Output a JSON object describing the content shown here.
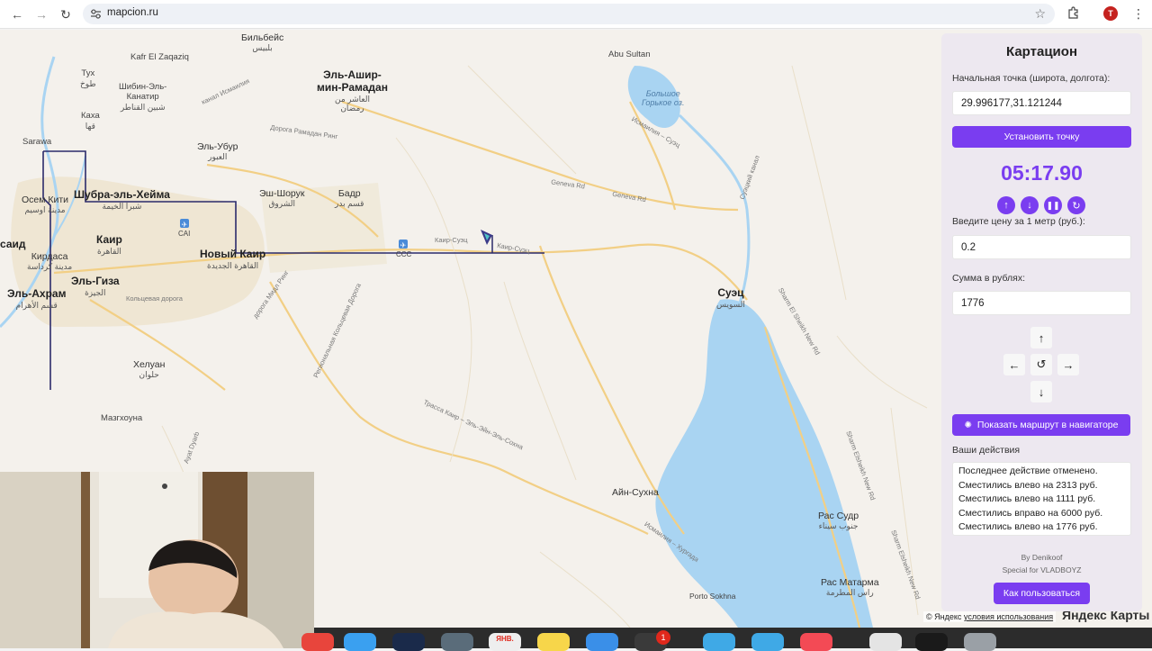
{
  "browser": {
    "url": "mapcion.ru",
    "profile_initial": "T",
    "icons": {
      "back": "arrow-left-icon",
      "forward": "arrow-right-icon",
      "reload": "reload-icon",
      "site": "site-settings-icon",
      "bookmark": "star-icon",
      "extensions": "puzzle-icon",
      "menu": "more-vert-icon"
    }
  },
  "map": {
    "labels": [
      {
        "id": "bilbeis",
        "name": "Бильбейс",
        "sub": "بلبيس",
        "cls": "mid"
      },
      {
        "id": "tukh",
        "name": "Тух",
        "sub": "طوخ",
        "cls": ""
      },
      {
        "id": "kafr",
        "name": "Kafr El Zaqaziq",
        "sub": "",
        "cls": ""
      },
      {
        "id": "shibin",
        "name": "Шибин-Эль-\nКанатир",
        "sub": "شبين القناطر",
        "cls": ""
      },
      {
        "id": "ashir",
        "name": "Эль-Ашир-\nмин-Рамадан",
        "sub": "العاشر من\nرمضان",
        "cls": "big"
      },
      {
        "id": "abusultan",
        "name": "Abu Sultan",
        "sub": "",
        "cls": ""
      },
      {
        "id": "lake",
        "name": "Большое\nГорькое оз.",
        "sub": "",
        "cls": "water"
      },
      {
        "id": "kaha",
        "name": "Каха",
        "sub": "قها",
        "cls": ""
      },
      {
        "id": "sarawa",
        "name": "Sarawa",
        "sub": "",
        "cls": ""
      },
      {
        "id": "ubur",
        "name": "Эль-Убур",
        "sub": "العبور",
        "cls": "mid"
      },
      {
        "id": "osim",
        "name": "Осем Кити",
        "sub": "مدينة اوسيم",
        "cls": "mid"
      },
      {
        "id": "shubra",
        "name": "Шубра-эль-Хейма",
        "sub": "شبرا الخيمة",
        "cls": "big"
      },
      {
        "id": "shorouk",
        "name": "Эш-Шорук",
        "sub": "الشروق",
        "cls": "mid"
      },
      {
        "id": "badr",
        "name": "Бадр",
        "sub": "قسم بدر",
        "cls": "mid"
      },
      {
        "id": "cai",
        "name": "CAI",
        "sub": "",
        "cls": ""
      },
      {
        "id": "cairo",
        "name": "Каир",
        "sub": "القاهرة",
        "cls": "big"
      },
      {
        "id": "newcairo",
        "name": "Новый Каир",
        "sub": "القاهرة الجديدة",
        "cls": "big"
      },
      {
        "id": "ccc",
        "name": "CCC",
        "sub": "",
        "cls": ""
      },
      {
        "id": "kirdasa",
        "name": "Кирдаса",
        "sub": "مدينة كرداسة",
        "cls": "mid"
      },
      {
        "id": "giza",
        "name": "Эль-Гиза",
        "sub": "الجيزة",
        "cls": "big"
      },
      {
        "id": "ahram",
        "name": "Эль-Ахрам",
        "sub": "قسم الأهرام",
        "cls": "big"
      },
      {
        "id": "said",
        "name": "саид",
        "sub": "",
        "cls": "big"
      },
      {
        "id": "suez",
        "name": "Суэц",
        "sub": "السويس",
        "cls": "big"
      },
      {
        "id": "helwan",
        "name": "Хелуан",
        "sub": "حلوان",
        "cls": "mid"
      },
      {
        "id": "mazghouna",
        "name": "Мазгхоуна",
        "sub": "",
        "cls": ""
      },
      {
        "id": "ainsukhna",
        "name": "Айн-Сухна",
        "sub": "",
        "cls": "mid"
      },
      {
        "id": "rassudr",
        "name": "Рас Судр",
        "sub": "جنوب سيناء",
        "cls": "mid"
      },
      {
        "id": "rasmatarma",
        "name": "Рас Матарма",
        "sub": "راس المطرمة",
        "cls": "mid"
      },
      {
        "id": "portosokhna",
        "name": "Porto Sokhna",
        "sub": "",
        "cls": ""
      }
    ],
    "roads": [
      {
        "id": "r1",
        "name": "канал Исмаилия"
      },
      {
        "id": "r2",
        "name": "Дорога Рамадан Ринг"
      },
      {
        "id": "r3",
        "name": "Исмаилия – Суэц"
      },
      {
        "id": "r4",
        "name": "Суэцкий канал"
      },
      {
        "id": "r5",
        "name": "Geneva Rd"
      },
      {
        "id": "r6",
        "name": "Geneva Rd"
      },
      {
        "id": "r7",
        "name": "Каир-Суэц"
      },
      {
        "id": "r8",
        "name": "Каир-Суэц"
      },
      {
        "id": "r9",
        "name": "Кольцевая дорога"
      },
      {
        "id": "r10",
        "name": "дорога Мидл Ринг"
      },
      {
        "id": "r11",
        "name": "Региональная Кольцевая Дорога"
      },
      {
        "id": "r12",
        "name": "Sharm El Sheikh New Rd"
      },
      {
        "id": "r13",
        "name": "Трасса Каир – Эль-Эйн-Эль-Сохна"
      },
      {
        "id": "r14",
        "name": "Исмаилия – Хургада"
      },
      {
        "id": "r15",
        "name": "Sharm Elsheikh New Rd"
      },
      {
        "id": "r16",
        "name": "Sharm Elsheikh New Rd"
      },
      {
        "id": "r17",
        "name": "Ayat Dyarb"
      }
    ],
    "copyright": "© Яндекс",
    "terms": "условия использования",
    "provider": "Яндекс Карты"
  },
  "panel": {
    "title": "Картацион",
    "start_label": "Начальная точка (широта, долгота):",
    "start_value": "29.996177,31.121244",
    "set_point_btn": "Установить точку",
    "timer": "05:17.90",
    "price_label": "Введите цену за 1 метр (руб.):",
    "price_value": "0.2",
    "sum_label": "Сумма в рублях:",
    "sum_value": "1776",
    "route_btn": "Показать маршрут в навигаторе",
    "actions_label": "Ваши действия",
    "actions": [
      "Последнее действие отменено.",
      "Сместились влево на 2313 руб.",
      "Сместились влево на 1111 руб.",
      "Сместились вправо на 6000 руб.",
      "Сместились влево на 1776 руб."
    ],
    "credit_author": "By Denikoof",
    "credit_special": "Special for VLADBOYZ",
    "howto_btn": "Как пользоваться"
  },
  "dock": {
    "calendar_label": "ЯНВ.",
    "badge_count": "1"
  },
  "colors": {
    "accent": "#7a3df0",
    "route": "#2b2a6b",
    "water": "#a9d4f2",
    "road": "#f2cf85"
  }
}
